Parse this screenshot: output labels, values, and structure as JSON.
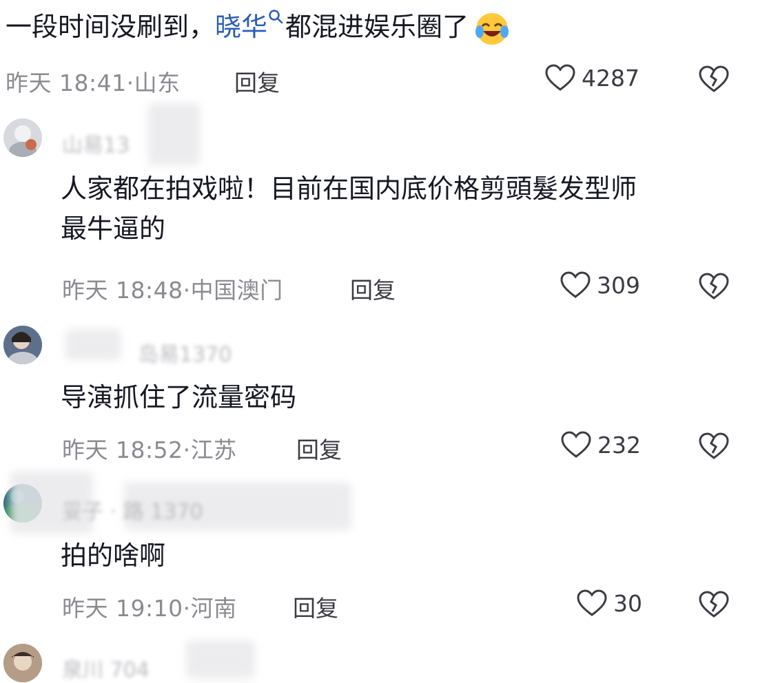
{
  "top_comment": {
    "text_before": "一段时间没刷到，",
    "link_text": "晓华",
    "text_after": "都混进娱乐圈了",
    "emoji": "laughing-crying-emoji",
    "time": "昨天 18:41",
    "location": "山东",
    "reply_label": "回复",
    "likes": "4287"
  },
  "comments": [
    {
      "username": "山易13",
      "text_line1": "人家都在拍戏啦！目前在国内底价格剪頭髮发型师",
      "text_line2": "最牛逼的",
      "time": "昨天 18:48",
      "location": "中国澳门",
      "reply_label": "回复",
      "likes": "309"
    },
    {
      "username": "岛易1370",
      "text_line1": "导演抓住了流量密码",
      "time": "昨天 18:52",
      "location": "江苏",
      "reply_label": "回复",
      "likes": "232"
    },
    {
      "username": "妥子 · 路 1370",
      "text_line1": "拍的啥啊",
      "time": "昨天 19:10",
      "location": "河南",
      "reply_label": "回复",
      "likes": "30"
    },
    {
      "username": "泉川 704"
    }
  ],
  "colors": {
    "link": "#2b5db8",
    "meta": "#8a8b91",
    "text": "#161823"
  }
}
